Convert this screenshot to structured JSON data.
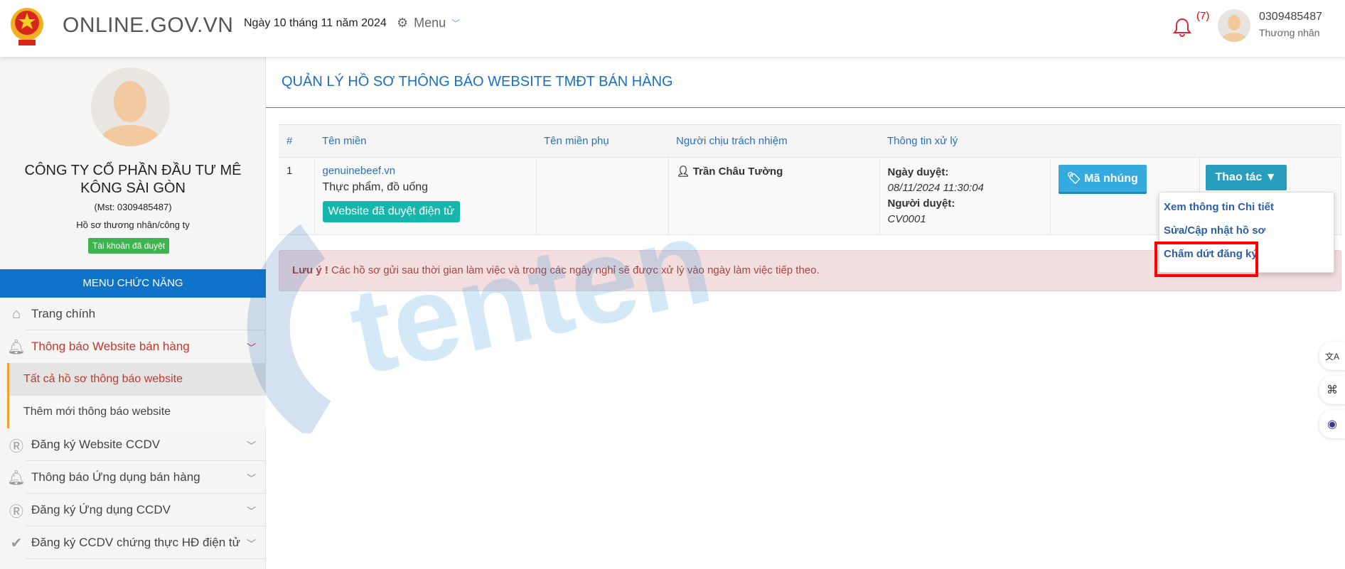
{
  "header": {
    "brand": "ONLINE.GOV.VN",
    "date": "Ngày 10 tháng 11 năm 2024",
    "menu_label": "Menu",
    "notification_count": "(7)",
    "username": "0309485487",
    "role": "Thương nhân"
  },
  "profile": {
    "company": "CÔNG TY CỔ PHẦN ĐẦU TƯ MÊ KÔNG SÀI GÒN",
    "mst": "(Mst: 0309485487)",
    "type": "Hồ sơ thương nhân/công ty",
    "status": "Tài khoản đã duyệt"
  },
  "sidebar": {
    "menu_title": "MENU CHỨC NĂNG",
    "items": [
      {
        "label": "Trang chính",
        "icon": "home-icon"
      },
      {
        "label": "Thông báo Website bán hàng",
        "icon": "bell-icon"
      },
      {
        "label": "Tất cả hồ sơ thông báo website"
      },
      {
        "label": "Thêm mới thông báo website"
      },
      {
        "label": "Đăng ký Website CCDV",
        "icon": "registered-icon"
      },
      {
        "label": "Thông báo Ứng dụng bán hàng",
        "icon": "bell-icon"
      },
      {
        "label": "Đăng ký Ứng dụng CCDV",
        "icon": "registered-icon"
      },
      {
        "label": "Đăng ký CCDV chứng thực HĐ điện tử",
        "icon": "check-circle-icon"
      }
    ]
  },
  "main": {
    "title": "QUẢN LÝ HỒ SƠ THÔNG BÁO WEBSITE TMĐT BÁN HÀNG",
    "columns": [
      "#",
      "Tên miền",
      "Tên miền phụ",
      "Người chịu trách nhiệm",
      "Thông tin xử lý"
    ],
    "rows": [
      {
        "index": "1",
        "domain": "genuinebeef.vn",
        "category": "Thực phẩm, đồ uống",
        "status": "Website đã duyệt điện tử",
        "subdomain": "",
        "person": "Trần Châu Tường",
        "approved_label": "Ngày duyệt:",
        "approved_date": "08/11/2024 11:30:04",
        "approver_label": "Người duyệt:",
        "approver": "CV0001",
        "embed_button": "Mã nhúng",
        "action_button": "Thao tác"
      }
    ],
    "dropdown": [
      "Xem thông tin Chi tiết",
      "Sửa/Cập nhật hồ sơ",
      "Chấm dứt đăng ký"
    ],
    "alert_strong": "Lưu ý !",
    "alert_text": " Các hồ sơ gửi sau thời gian làm việc và trong các ngày nghỉ sẽ được xử lý vào ngày làm việc tiếp theo."
  },
  "watermark": {
    "text": "tenten by GMO TÊN MIỀN & WEB HOSTING"
  },
  "floating": [
    {
      "icon": "translate-icon",
      "glyph": "文A"
    },
    {
      "icon": "apps-icon",
      "glyph": "⌘"
    },
    {
      "icon": "assistant-icon",
      "glyph": "◉"
    }
  ]
}
